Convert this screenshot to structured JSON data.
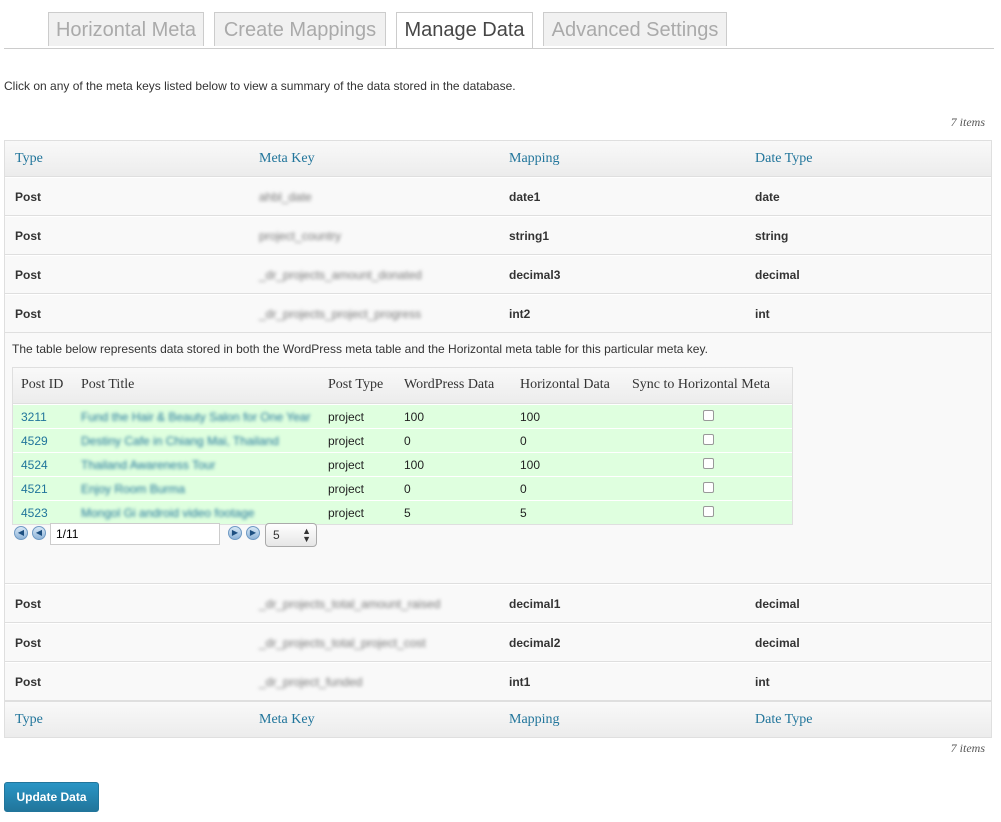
{
  "tabs": [
    {
      "label": "Horizontal Meta",
      "active": false
    },
    {
      "label": "Create Mappings",
      "active": false
    },
    {
      "label": "Manage Data",
      "active": true
    },
    {
      "label": "Advanced Settings",
      "active": false
    }
  ],
  "intro_text": "Click on any of the meta keys listed below to view a summary of the data stored in the database.",
  "items_count": "7 items",
  "columns": {
    "type": "Type",
    "meta_key": "Meta Key",
    "mapping": "Mapping",
    "date_type": "Date Type"
  },
  "rows_top": [
    {
      "type": "Post",
      "meta_key": "ahbl_date",
      "mapping": "date1",
      "date_type": "date"
    },
    {
      "type": "Post",
      "meta_key": "project_country",
      "mapping": "string1",
      "date_type": "string"
    },
    {
      "type": "Post",
      "meta_key": "_dr_projects_amount_donated",
      "mapping": "decimal3",
      "date_type": "decimal"
    },
    {
      "type": "Post",
      "meta_key": "_dr_projects_project_progress",
      "mapping": "int2",
      "date_type": "int"
    }
  ],
  "expanded": {
    "note": "The table below represents data stored in both the WordPress meta table and the Horizontal meta table for this particular meta key.",
    "columns": {
      "post_id": "Post ID",
      "post_title": "Post Title",
      "post_type": "Post Type",
      "wp_data": "WordPress Data",
      "hz_data": "Horizontal Data",
      "sync": "Sync to Horizontal Meta"
    },
    "rows": [
      {
        "post_id": "3211",
        "post_title": "Fund the Hair & Beauty Salon for One Year",
        "post_type": "project",
        "wp_data": "100",
        "hz_data": "100"
      },
      {
        "post_id": "4529",
        "post_title": "Destiny Cafe in Chiang Mai, Thailand",
        "post_type": "project",
        "wp_data": "0",
        "hz_data": "0"
      },
      {
        "post_id": "4524",
        "post_title": "Thailand Awareness Tour",
        "post_type": "project",
        "wp_data": "100",
        "hz_data": "100"
      },
      {
        "post_id": "4521",
        "post_title": "Enjoy Room Burma",
        "post_type": "project",
        "wp_data": "0",
        "hz_data": "0"
      },
      {
        "post_id": "4523",
        "post_title": "Mongol Gi android video footage",
        "post_type": "project",
        "wp_data": "5",
        "hz_data": "5"
      }
    ],
    "pager": {
      "page": "1/11",
      "per_page": "5"
    }
  },
  "rows_bottom": [
    {
      "type": "Post",
      "meta_key": "_dr_projects_total_amount_raised",
      "mapping": "decimal1",
      "date_type": "decimal"
    },
    {
      "type": "Post",
      "meta_key": "_dr_projects_total_project_cost",
      "mapping": "decimal2",
      "date_type": "decimal"
    },
    {
      "type": "Post",
      "meta_key": "_dr_project_funded",
      "mapping": "int1",
      "date_type": "int"
    }
  ],
  "update_button": "Update Data",
  "colors": {
    "link": "#21759b",
    "row_highlight": "#dfffdf",
    "button": "#21759b"
  }
}
